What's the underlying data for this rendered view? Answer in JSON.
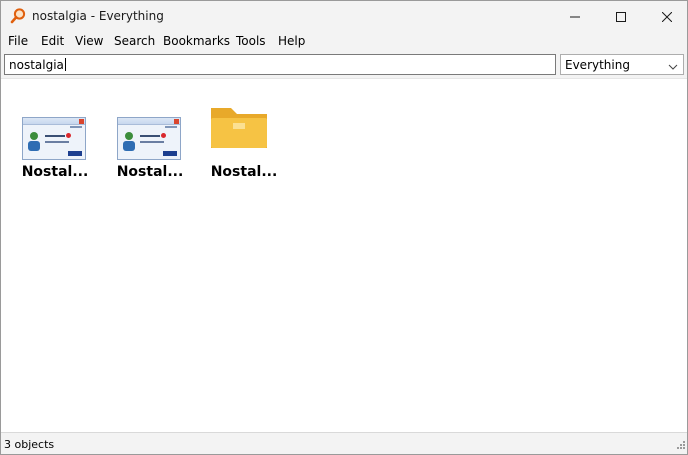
{
  "window": {
    "title": "nostalgia - Everything",
    "icons": {
      "app": "magnifier-icon",
      "minimize": "minimize-icon",
      "maximize": "maximize-icon",
      "close": "close-icon"
    }
  },
  "menu": {
    "items": [
      "File",
      "Edit",
      "View",
      "Search",
      "Bookmarks",
      "Tools",
      "Help"
    ]
  },
  "search": {
    "value": "nostalgia",
    "filter_selected": "Everything"
  },
  "results": {
    "items": [
      {
        "label": "Nostal...",
        "kind": "image-thumbnail"
      },
      {
        "label": "Nostal...",
        "kind": "image-thumbnail"
      },
      {
        "label": "Nostal...",
        "kind": "folder"
      }
    ]
  },
  "status": {
    "text": "3 objects"
  },
  "colors": {
    "chrome": "#f3f3f3",
    "folder": "#f6c344",
    "accent_orange": "#e0600e"
  }
}
